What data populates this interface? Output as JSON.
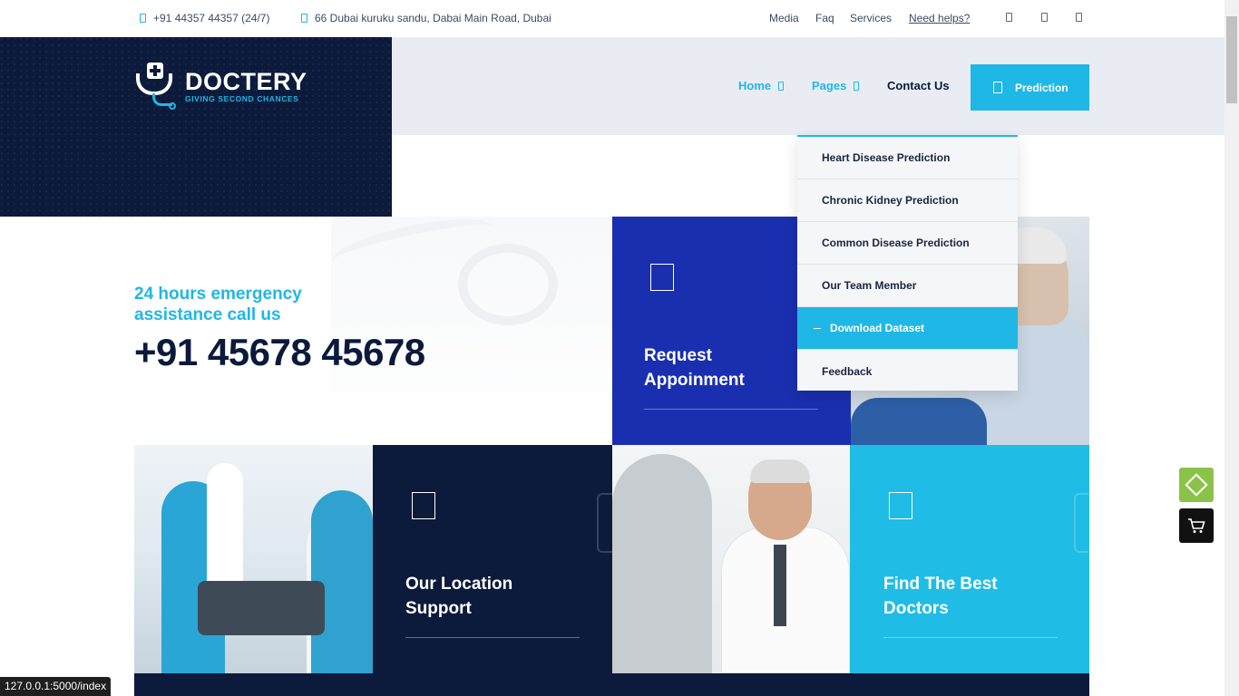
{
  "topbar": {
    "phone": "+91 44357 44357 (24/7)",
    "address": "66 Dubai kuruku sandu, Dabai Main Road, Dubai",
    "links": [
      "Media",
      "Faq",
      "Services",
      "Need helps?"
    ]
  },
  "brand": {
    "name": "DOCTERY",
    "tagline": "GIVING SECOND CHANCES"
  },
  "nav": {
    "home": "Home",
    "pages": "Pages",
    "contact": "Contact Us",
    "prediction": "Prediction"
  },
  "dropdown": {
    "items": [
      "Heart Disease Prediction",
      "Chronic Kidney Prediction",
      "Common Disease Prediction",
      "Our Team Member",
      "Download Dataset",
      "Feedback"
    ],
    "active_index": 4
  },
  "hero": {
    "emergency_line1": "24 hours emergency",
    "emergency_line2": "assistance call us",
    "phone": "+91 45678 45678"
  },
  "tiles": {
    "request_line1": "Request",
    "request_line2": "Appoinment",
    "location_line1": "Our Location",
    "location_line2": "Support",
    "doctors_line1": "Find The Best",
    "doctors_line2": "Doctors"
  },
  "status": {
    "url": "127.0.0.1:5000/index"
  },
  "colors": {
    "accent": "#1fb7e6",
    "navy": "#0c1a3b",
    "royal": "#1a2fb0"
  }
}
